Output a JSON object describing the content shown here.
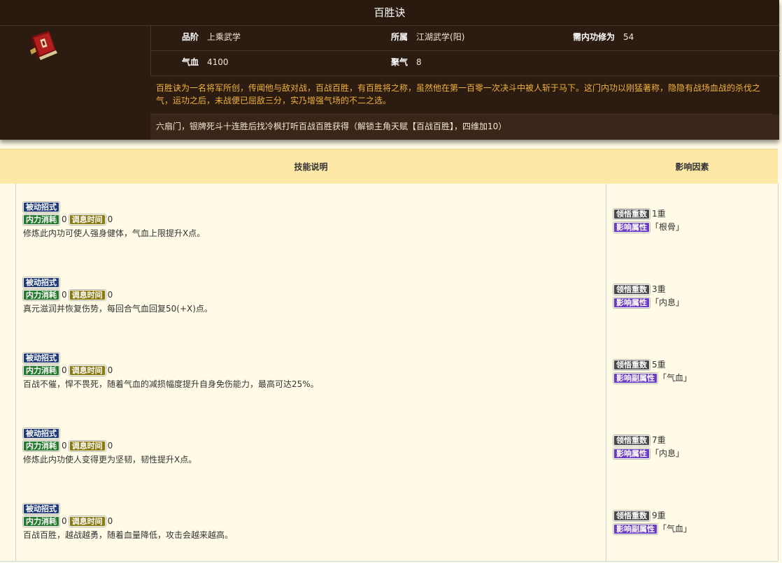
{
  "header": {
    "title": "百胜诀",
    "icon": "book-icon",
    "grade_label": "品阶",
    "grade_value": "上乘武学",
    "school_label": "所属",
    "school_value": "江湖武学(阳)",
    "req_label": "需内功修为",
    "req_value": "54",
    "hp_label": "气血",
    "hp_value": "4100",
    "qi_label": "聚气",
    "qi_value": "8",
    "description": "百胜诀为一名将军所创，传闻他与敌对战，百战百胜，有百胜将之称，虽然他在第一百零一次决斗中被人斩于马下。这门内功以刚猛著称，隐隐有战场血战的杀伐之气，运功之后，未战便已屈敌三分，实乃增强气场的不二之选。",
    "source": "六扇门，银牌死斗十连胜后找冷枫打听百战百胜获得（解锁主角天赋【百战百胜】，四维加10）"
  },
  "table": {
    "col_desc": "技能说明",
    "col_factor": "影响因素",
    "rows": [
      {
        "type_tag": "被动招式",
        "cost_tag": "内力消耗",
        "cost": "0",
        "time_tag": "调息时间",
        "time": "0",
        "text": "修炼此内功可使人强身健体，气血上限提升X点。",
        "level_tag": "领悟重数",
        "level": "1重",
        "attr_tag": "影响属性",
        "attr": "「根骨」"
      },
      {
        "type_tag": "被动招式",
        "cost_tag": "内力消耗",
        "cost": "0",
        "time_tag": "调息时间",
        "time": "0",
        "text": "真元滋润并恢复伤势，每回合气血回复50(+X)点。",
        "level_tag": "领悟重数",
        "level": "3重",
        "attr_tag": "影响属性",
        "attr": "「内息」"
      },
      {
        "type_tag": "被动招式",
        "cost_tag": "内力消耗",
        "cost": "0",
        "time_tag": "调息时间",
        "time": "0",
        "text": "百战不催，悍不畏死，随着气血的减损幅度提升自身免伤能力，最高可达25%。",
        "level_tag": "领悟重数",
        "level": "5重",
        "attr_tag": "影响副属性",
        "attr": "「气血」"
      },
      {
        "type_tag": "被动招式",
        "cost_tag": "内力消耗",
        "cost": "0",
        "time_tag": "调息时间",
        "time": "0",
        "text": "修炼此内功使人变得更为坚韧，韧性提升X点。",
        "level_tag": "领悟重数",
        "level": "7重",
        "attr_tag": "影响属性",
        "attr": "「内息」"
      },
      {
        "type_tag": "被动招式",
        "cost_tag": "内力消耗",
        "cost": "0",
        "time_tag": "调息时间",
        "time": "0",
        "text": "百战百胜，越战越勇，随着血量降低，攻击会越来越高。",
        "level_tag": "领悟重数",
        "level": "9重",
        "attr_tag": "影响副属性",
        "attr": "「气血」"
      }
    ]
  }
}
